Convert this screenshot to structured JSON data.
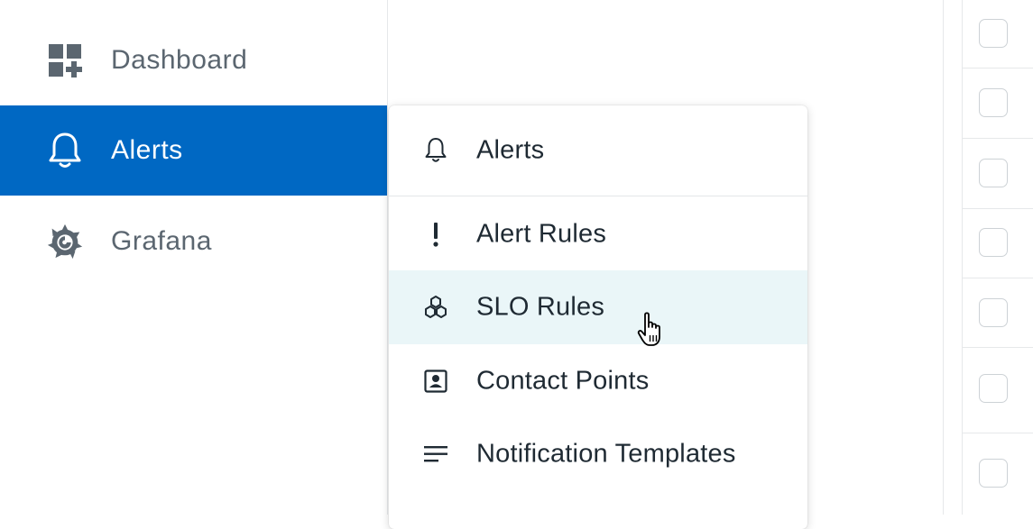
{
  "sidebar": {
    "items": [
      {
        "label": "Dashboard",
        "icon": "dashboard-add-icon",
        "active": false
      },
      {
        "label": "Alerts",
        "icon": "bell-icon",
        "active": true
      },
      {
        "label": "Grafana",
        "icon": "grafana-logo-icon",
        "active": false
      }
    ]
  },
  "flyout": {
    "header": {
      "label": "Alerts",
      "icon": "bell-icon"
    },
    "items": [
      {
        "label": "Alert Rules",
        "icon": "exclamation-icon"
      },
      {
        "label": "SLO Rules",
        "icon": "hexagons-icon",
        "hovered": true
      },
      {
        "label": "Contact Points",
        "icon": "contact-card-icon"
      },
      {
        "label": "Notification Templates",
        "icon": "lines-icon"
      }
    ]
  },
  "colors": {
    "active_bg": "#0068c3",
    "hover_bg": "#eaf6f8",
    "nav_text": "#5b6670",
    "menu_text": "#1f2a33",
    "icon_gray": "#5b6670"
  }
}
